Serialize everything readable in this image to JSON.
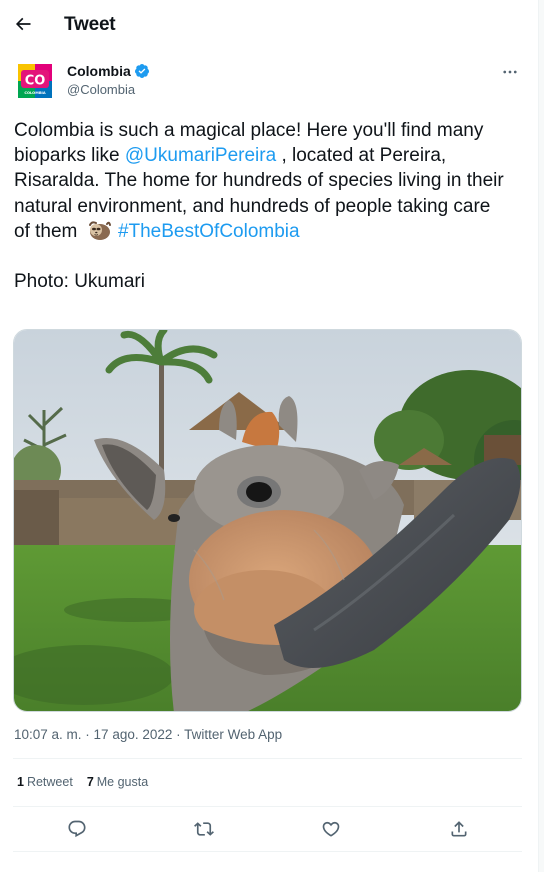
{
  "header": {
    "title": "Tweet"
  },
  "author": {
    "name": "Colombia",
    "handle": "@Colombia",
    "avatar_text": "CO",
    "avatar_subtext": "COLOMBIA"
  },
  "tweet": {
    "text_part1": "Colombia is such a magical place! Here you'll find many bioparks like ",
    "mention": "@UkumariPereira",
    "text_part2": " , located at Pereira, Risaralda. The home for hundreds of species living in their natural environment, and hundreds of people taking care of them ",
    "hashtag": "#TheBestOfColombia",
    "photo_credit": "Photo: Ukumari"
  },
  "meta": {
    "time": "10:07 a. m.",
    "separator": " · ",
    "date": "17 ago. 2022",
    "source": "Twitter Web App"
  },
  "stats": {
    "retweets_count": "1",
    "retweets_label": "Retweet",
    "likes_count": "7",
    "likes_label": "Me gusta"
  },
  "colors": {
    "link": "#1d9bf0",
    "text": "#0f1419",
    "secondary": "#536471",
    "border": "#eff3f4"
  }
}
